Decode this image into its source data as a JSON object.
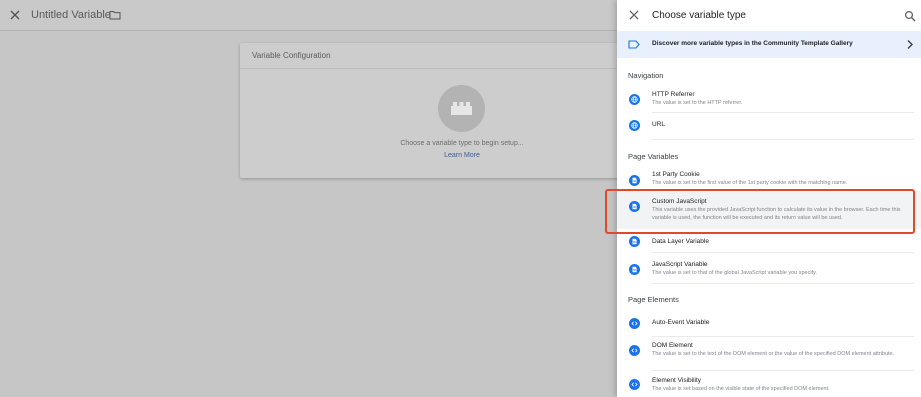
{
  "editor": {
    "title": "Untitled Variable",
    "card_title": "Variable Configuration",
    "hint": "Choose a variable type to begin setup...",
    "learn_more": "Learn More"
  },
  "panel": {
    "title": "Choose variable type",
    "discover": "Discover more variable types in the Community Template Gallery",
    "sections": {
      "navigation": "Navigation",
      "page_variables": "Page Variables",
      "page_elements": "Page Elements"
    },
    "items": [
      {
        "name": "HTTP Referrer",
        "desc": "The value is set to the HTTP referrer.",
        "icon": "globe-icon"
      },
      {
        "name": "URL",
        "desc": "",
        "icon": "globe-icon"
      },
      {
        "name": "1st Party Cookie",
        "desc": "The value is set to the first value of the 1st party cookie with the matching name.",
        "icon": "document-icon"
      },
      {
        "name": "Custom JavaScript",
        "desc": "This variable uses the provided JavaScript function to calculate its value in the browser. Each time this variable is used, the function will be executed and its return value will be used.",
        "icon": "document-icon"
      },
      {
        "name": "Data Layer Variable",
        "desc": "",
        "icon": "document-icon"
      },
      {
        "name": "JavaScript Variable",
        "desc": "The value is set to that of the global JavaScript variable you specify.",
        "icon": "document-icon"
      },
      {
        "name": "Auto-Event Variable",
        "desc": "",
        "icon": "code-icon"
      },
      {
        "name": "DOM Element",
        "desc": "The value is set to the text of the DOM element or the value of the specified DOM element attribute.",
        "icon": "code-icon"
      },
      {
        "name": "Element Visibility",
        "desc": "The value is set based on the visible state of the specified DOM element.",
        "icon": "code-icon"
      }
    ]
  },
  "colors": {
    "accent": "#1a73e8",
    "discover_bg": "#e8f0fe",
    "highlight_border": "#e2492a"
  }
}
